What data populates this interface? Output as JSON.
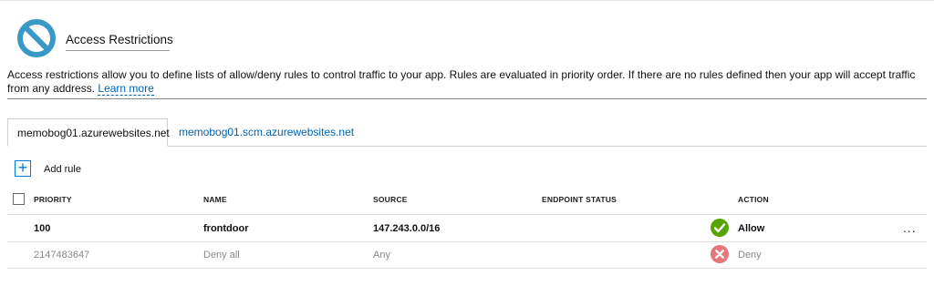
{
  "blade": {
    "icon": "no-entry-icon",
    "title": "Access Restrictions",
    "description": "Access restrictions allow you to define lists of allow/deny rules to control traffic to your app. Rules are evaluated in priority order. If there are no rules defined then your app will accept traffic from any address.",
    "learn_more": "Learn more"
  },
  "tabs": [
    {
      "label": "memobog01.azurewebsites.net",
      "active": true
    },
    {
      "label": "memobog01.scm.azurewebsites.net",
      "active": false
    }
  ],
  "toolbar": {
    "add_rule_label": "Add rule",
    "add_icon": "plus-icon"
  },
  "table": {
    "headers": {
      "priority": "PRIORITY",
      "name": "NAME",
      "source": "SOURCE",
      "endpoint_status": "ENDPOINT STATUS",
      "action": "ACTION"
    },
    "rows": [
      {
        "priority": "100",
        "name": "frontdoor",
        "source": "147.243.0.0/16",
        "endpoint_status": "",
        "action": "Allow",
        "action_icon": "check-circle-icon",
        "more": "..."
      },
      {
        "priority": "2147483647",
        "name": "Deny all",
        "source": "Any",
        "endpoint_status": "",
        "action": "Deny",
        "action_icon": "x-circle-icon"
      }
    ]
  },
  "colors": {
    "accent": "#0078d4",
    "link": "#0063b1",
    "allow": "#57a300",
    "deny": "#e8747c",
    "icon_blue": "#3999c6"
  }
}
